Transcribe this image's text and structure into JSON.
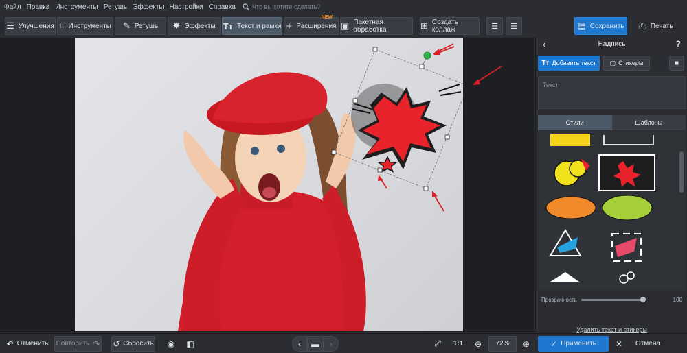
{
  "menu": {
    "items": [
      "Файл",
      "Правка",
      "Инструменты",
      "Ретушь",
      "Эффекты",
      "Настройки",
      "Справка"
    ],
    "search_placeholder": "Что вы хотите сделать?"
  },
  "toolbar": {
    "tabs": [
      {
        "label": "Улучшения",
        "icon": "sliders-icon"
      },
      {
        "label": "Инструменты",
        "icon": "crop-icon"
      },
      {
        "label": "Ретушь",
        "icon": "brush-icon"
      },
      {
        "label": "Эффекты",
        "icon": "magic-wand-icon"
      },
      {
        "label": "Текст и рамки",
        "icon": "text-icon"
      },
      {
        "label": "Расширения",
        "icon": "plus-icon"
      },
      {
        "label": "Пакетная обработка",
        "icon": "image-icon"
      },
      {
        "label": "Создать коллаж",
        "icon": "collage-icon"
      }
    ],
    "new_badge": "NEW",
    "save_label": "Сохранить",
    "print_label": "Печать"
  },
  "panel": {
    "title": "Надпись",
    "help": "?",
    "add_text_label": "Добавить текст",
    "stickers_label": "Стикеры",
    "text_placeholder": "Текст",
    "tab_styles": "Стили",
    "tab_templates": "Шаблоны",
    "opacity_label": "Прозрачность",
    "opacity_value": "100",
    "opacity_level": 1.0,
    "delete_link": "Удалить текст и стикеры"
  },
  "bottom": {
    "undo_label": "Отменить",
    "redo_label": "Повторить",
    "reset_label": "Сбросить",
    "ratio_label": "1:1",
    "zoom_value": "72%",
    "apply_label": "Применить",
    "cancel_label": "Отмена"
  },
  "colors": {
    "accent": "#1e78d0",
    "sticker_red": "#e8232b",
    "arrow_red": "#d81f26",
    "handle_green": "#2db34a"
  }
}
